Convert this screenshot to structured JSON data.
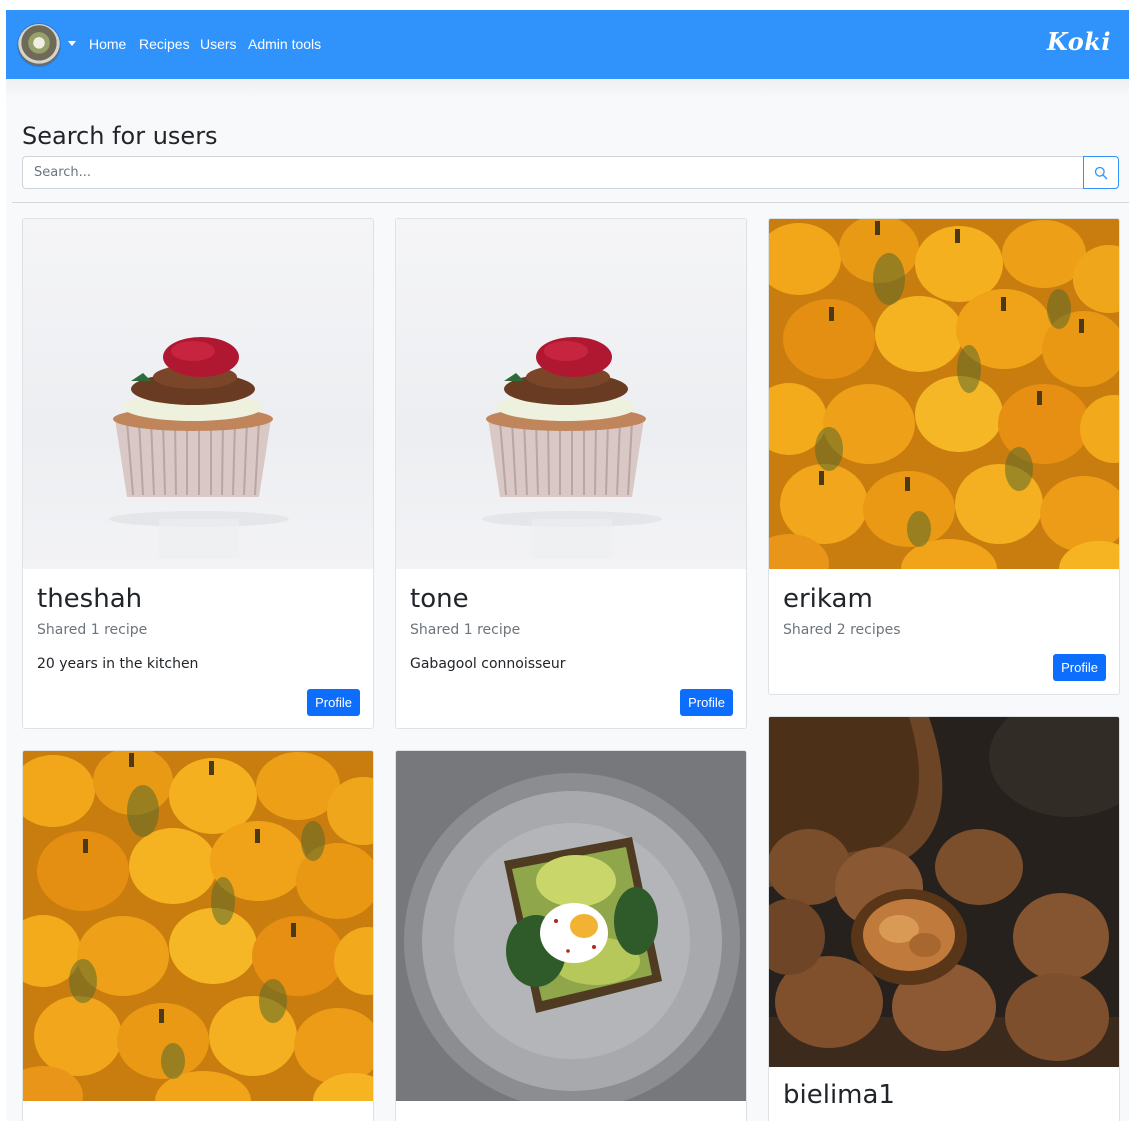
{
  "navbar": {
    "links": [
      "Home",
      "Recipes",
      "Users",
      "Admin tools"
    ],
    "brand": "Koki",
    "color": "#2f93fb"
  },
  "page": {
    "title": "Search for users",
    "search_placeholder": "Search..."
  },
  "users": [
    {
      "name": "theshah",
      "shared": "Shared 1 recipe",
      "bio": "20 years in the kitchen",
      "button": "Profile",
      "image": "cupcake"
    },
    {
      "name": "tone",
      "shared": "Shared 1 recipe",
      "bio": "Gabagool connoisseur",
      "button": "Profile",
      "image": "cupcake"
    },
    {
      "name": "erikam",
      "shared": "Shared 2 recipes",
      "bio": "",
      "button": "Profile",
      "image": "pumpkins"
    },
    {
      "name": "bielima1",
      "image": "walnuts"
    }
  ],
  "accent": "#0d6efd"
}
